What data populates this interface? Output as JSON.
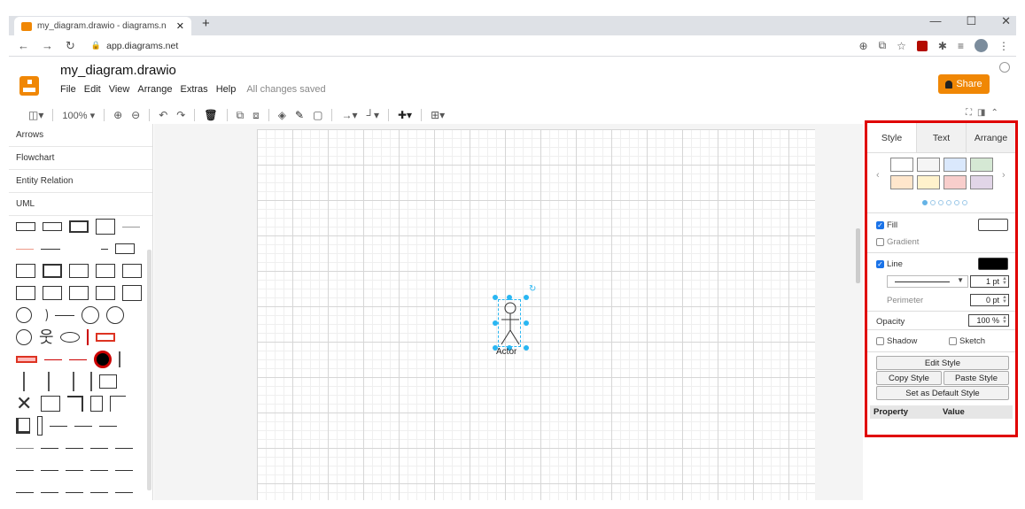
{
  "browser": {
    "tab_title": "my_diagram.drawio - diagrams.n",
    "tab_close": "✕",
    "new_tab": "+",
    "url": "app.diagrams.net",
    "window_controls": [
      "—",
      "☐",
      "✕"
    ]
  },
  "app": {
    "doc_title": "my_diagram.drawio",
    "menus": [
      "File",
      "Edit",
      "View",
      "Arrange",
      "Extras",
      "Help"
    ],
    "save_status": "All changes saved",
    "share_label": "Share",
    "accent_color": "#f08705"
  },
  "toolbar": {
    "zoom": "100%"
  },
  "sidebar": {
    "sections": [
      "Arrows",
      "Flowchart",
      "Entity Relation",
      "UML"
    ]
  },
  "canvas": {
    "shape_label": "Actor"
  },
  "format_panel": {
    "tabs": [
      "Style",
      "Text",
      "Arrange"
    ],
    "fill_label": "Fill",
    "gradient_label": "Gradient",
    "line_label": "Line",
    "line_width": "1 pt",
    "perimeter_label": "Perimeter",
    "perimeter_value": "0 pt",
    "opacity_label": "Opacity",
    "opacity_value": "100 %",
    "shadow_label": "Shadow",
    "sketch_label": "Sketch",
    "edit_style": "Edit Style",
    "copy_style": "Copy Style",
    "paste_style": "Paste Style",
    "set_default": "Set as Default Style",
    "property_header": "Property",
    "value_header": "Value",
    "swatch_colors": [
      "#ffffff",
      "#f5f5f5",
      "#dae8fc",
      "#d5e8d4",
      "#ffe6cc",
      "#fff2cc",
      "#f8cecc",
      "#e1d5e7"
    ],
    "highlight_color": "#e00000"
  }
}
